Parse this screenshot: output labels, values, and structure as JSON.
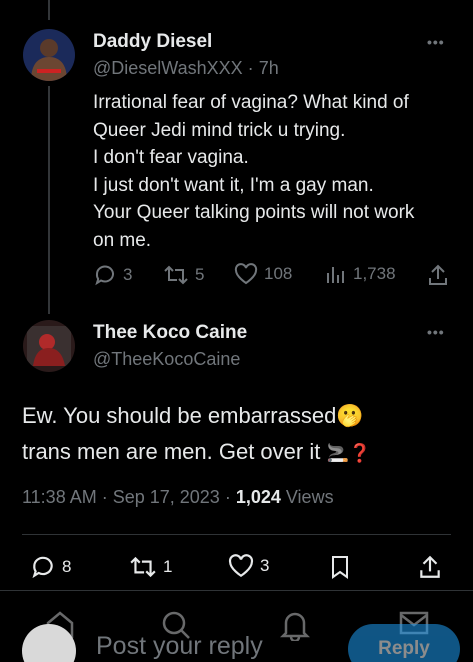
{
  "parent_tweet": {
    "author_name": "Daddy Diesel",
    "handle": "@DieselWashXXX",
    "separator": "·",
    "time": "7h",
    "more_label": "•••",
    "lines": [
      "Irrational fear of vagina?  What kind of",
      "Queer Jedi mind trick u trying.",
      "I don't fear vagina.",
      "I just don't want it, I'm a gay man.",
      "Your Queer talking points will not work",
      "on me."
    ],
    "replies": "3",
    "retweets": "5",
    "likes": "108",
    "views": "1,738"
  },
  "main_tweet": {
    "author_name": "Thee Koco Caine",
    "handle": "@TheeKocoCaine",
    "more_label": "•••",
    "line1": "Ew.  You should be embarrassed",
    "line2": "trans men are men. Get over it",
    "emoji1": "🫢",
    "emoji2": "🚬❓",
    "time": "11:38 AM",
    "sep1": " · ",
    "date": "Sep 17, 2023",
    "sep2": " · ",
    "views_count": "1,024",
    "views_label": " Views",
    "replies": "8",
    "retweets": "1",
    "likes": "3"
  },
  "composer": {
    "placeholder": "Post your reply",
    "reply_button": "Reply"
  },
  "colors": {
    "background": "#000000",
    "text": "#e7e9ea",
    "muted": "#71767b",
    "accent": "#1d9bf0",
    "border": "#2f3336"
  }
}
